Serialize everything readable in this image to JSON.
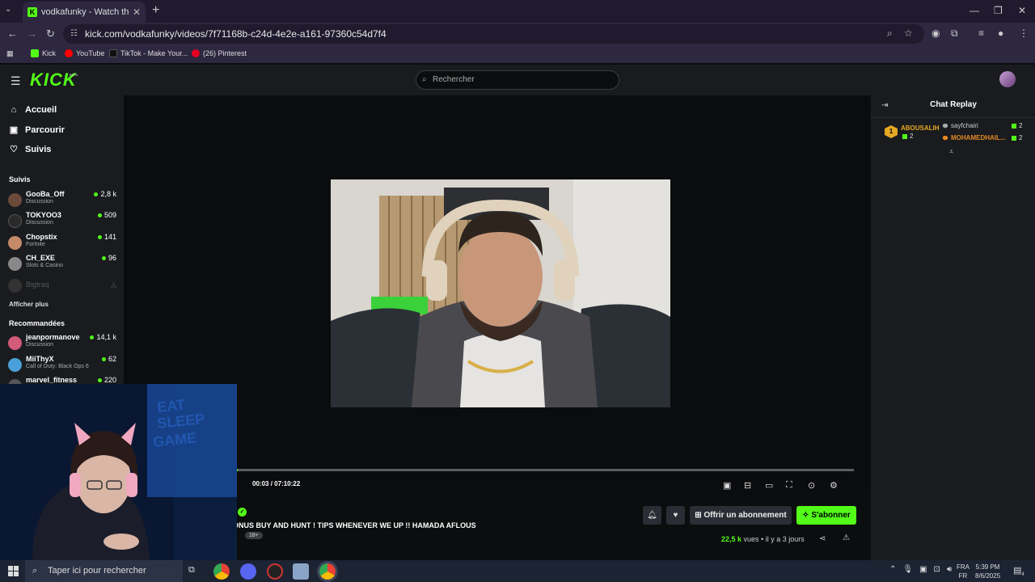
{
  "browser": {
    "tab_title": "vodkafunky - Watch the VOD o",
    "tab_favicon_text": "K",
    "url": "kick.com/vodkafunky/videos/7f71168b-c24d-4e2e-a161-97360c54d7f4",
    "bookmarks": [
      {
        "label": "Kick",
        "color": "#53fc18"
      },
      {
        "label": "YouTube",
        "color": "#ff0000"
      },
      {
        "label": "TikTok - Make Your...",
        "color": "#111111"
      },
      {
        "label": "(26) Pinterest",
        "color": "#e60023"
      }
    ]
  },
  "header": {
    "logo": "KICK",
    "logo_badge": "BETA",
    "search_placeholder": "Rechercher"
  },
  "sidebar": {
    "nav": [
      {
        "label": "Accueil",
        "icon": "home-icon"
      },
      {
        "label": "Parcourir",
        "icon": "browse-icon"
      },
      {
        "label": "Suivis",
        "icon": "heart-icon"
      }
    ],
    "following_title": "Suivis",
    "following": [
      {
        "name": "GooBa_Off",
        "category": "Discussion",
        "viewers": "2,8 k",
        "avatar": "#6b4a3a"
      },
      {
        "name": "TOKYOO3",
        "category": "Discussion",
        "viewers": "509",
        "avatar": "#2a2a2a"
      },
      {
        "name": "Chopstix",
        "category": "Fortnite",
        "viewers": "141",
        "avatar": "#c48a6a"
      },
      {
        "name": "CH_EXE",
        "category": "Slots & Casino",
        "viewers": "96",
        "avatar": "#888888"
      }
    ],
    "offline": [
      {
        "name": "Bigtraq",
        "avatar": "#444444"
      }
    ],
    "show_more": "Afficher plus",
    "recommended_title": "Recommandées",
    "recommended": [
      {
        "name": "jeanpormanove",
        "category": "Discussion",
        "viewers": "14,1 k",
        "avatar": "#d45a7a"
      },
      {
        "name": "MiiThyX",
        "category": "Call of Duty: Black Ops 6",
        "viewers": "62",
        "avatar": "#4aa0d8"
      },
      {
        "name": "marvel_fitness",
        "category": "",
        "viewers": "220",
        "avatar": "#555555"
      }
    ]
  },
  "player": {
    "current_time": "00:03",
    "duration": "07:10:22",
    "time_separator": "/",
    "progress": 0.0001
  },
  "vod": {
    "title": "ONUS BUY AND HUNT ! TIPS WHENEVER WE UP !! HAMADA AFLOUS",
    "badge": "18+",
    "views_number": "22,5 k",
    "views_label": "vues",
    "dot": "•",
    "age": "il y a 3 jours",
    "gift_label": "Offrir un abonnement",
    "subscribe_label": "S'abonner"
  },
  "chat": {
    "title": "Chat Replay",
    "leaders": [
      {
        "rank": "1",
        "name": "ABOUSALIH",
        "count": "2",
        "color": "#e5a823"
      },
      {
        "name": "sayfchairi",
        "count": "2",
        "color": "#cccccc"
      },
      {
        "name": "MOHAMEDHAIL...",
        "count": "2",
        "color": "#e58a23"
      }
    ]
  },
  "taskbar": {
    "search_placeholder": "Taper ici pour rechercher",
    "lang_top": "FRA",
    "lang_bottom": "FR",
    "time": "5:39 PM",
    "date": "8/6/2025",
    "notif_count": "4"
  },
  "colors": {
    "accent": "#53fc18",
    "background": "#0b0e0f",
    "panel": "#191b1f"
  }
}
